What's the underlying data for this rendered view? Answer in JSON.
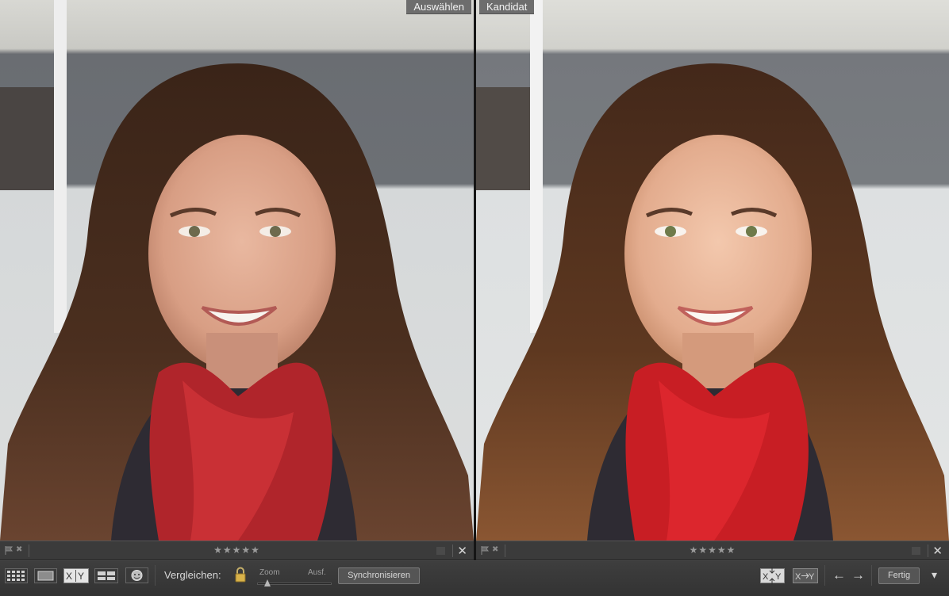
{
  "panes": {
    "left": {
      "label": "Auswählen"
    },
    "right": {
      "label": "Kandidat"
    }
  },
  "strips": {
    "left": {
      "stars": "★★★★★",
      "reject_glyph": "✖",
      "close_glyph": "✕"
    },
    "right": {
      "stars": "★★★★★",
      "reject_glyph": "✖",
      "close_glyph": "✕"
    }
  },
  "toolbar": {
    "compare_label": "Vergleichen:",
    "zoom_label": "Zoom",
    "fit_label": "Ausf.",
    "sync_label": "Synchronisieren",
    "done_label": "Fertig",
    "prev_arrow": "←",
    "next_arrow": "→",
    "menu_glyph": "▾"
  },
  "colors": {
    "panel": "#3b3b3b",
    "label_bg": "#6d6d6d",
    "scarf_left": "#b0252b",
    "scarf_right": "#c81e24"
  },
  "icons": [
    "grid-view-icon",
    "loupe-view-icon",
    "compare-view-icon",
    "survey-view-icon",
    "people-view-icon",
    "lock-icon",
    "swap-icon",
    "make-select-icon",
    "flag-icon",
    "reject-icon",
    "close-icon"
  ]
}
